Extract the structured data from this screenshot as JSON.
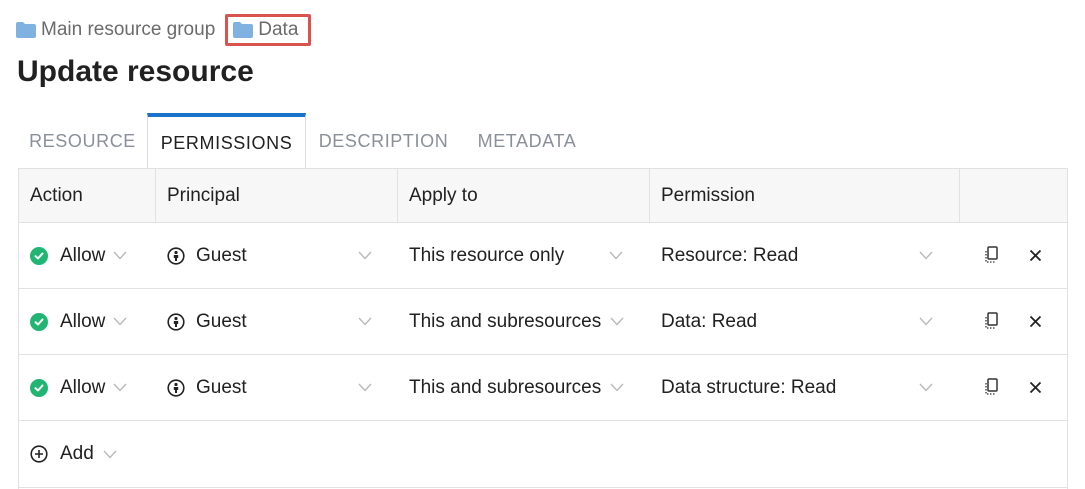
{
  "breadcrumb": [
    {
      "label": "Main resource group",
      "icon": "folder-icon"
    },
    {
      "label": "Data",
      "icon": "folder-icon"
    }
  ],
  "page_title": "Update resource",
  "tabs": [
    {
      "label": "RESOURCE",
      "active": false
    },
    {
      "label": "PERMISSIONS",
      "active": true
    },
    {
      "label": "DESCRIPTION",
      "active": false
    },
    {
      "label": "METADATA",
      "active": false
    }
  ],
  "table": {
    "headers": [
      "Action",
      "Principal",
      "Apply to",
      "Permission"
    ],
    "rows": [
      {
        "action": "Allow",
        "principal": "Guest",
        "apply_to": "This resource only",
        "permission": "Resource: Read"
      },
      {
        "action": "Allow",
        "principal": "Guest",
        "apply_to": "This and subresources",
        "permission": "Data: Read"
      },
      {
        "action": "Allow",
        "principal": "Guest",
        "apply_to": "This and subresources",
        "permission": "Data structure: Read"
      }
    ],
    "add_label": "Add"
  },
  "colors": {
    "accent": "#1a73c8",
    "allow_green": "#21b573",
    "highlight_red": "#d9534f",
    "folder_blue": "#7fb2e0"
  }
}
